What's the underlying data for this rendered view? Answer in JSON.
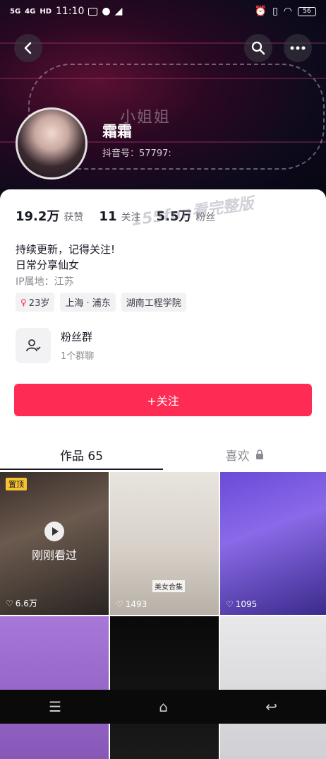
{
  "status_bar": {
    "signal1": "5G",
    "signal2": "4G",
    "hd": "HD",
    "time": "11:10",
    "battery": "56"
  },
  "header": {
    "nickname": "霜霜",
    "douyin_id": "抖音号：57797:",
    "deco_text": "小姐姐"
  },
  "stats": {
    "likes_num": "19.2万",
    "likes_label": "获赞",
    "following_num": "11",
    "following_label": "关注",
    "fans_num": "5.5万",
    "fans_label": "粉丝"
  },
  "watermark": "155fun看完整版",
  "bio": {
    "line1": "持续更新，记得关注!",
    "line2": "日常分享仙女"
  },
  "ip": "IP属地：江苏",
  "tags": {
    "age": "23岁",
    "location": "上海 · 浦东",
    "school": "湖南工程学院"
  },
  "fan_group": {
    "title": "粉丝群",
    "subtitle": "1个群聊"
  },
  "follow_button": "+关注",
  "tabs": {
    "works": "作品 65",
    "likes": "喜欢"
  },
  "thumbs": [
    {
      "pin": "置顶",
      "watched": "刚刚看过",
      "count": "6.6万"
    },
    {
      "collection": "美女合集",
      "count": "1493"
    },
    {
      "count": "1095"
    },
    {},
    {},
    {}
  ],
  "colors": {
    "accent": "#fe2c55"
  }
}
